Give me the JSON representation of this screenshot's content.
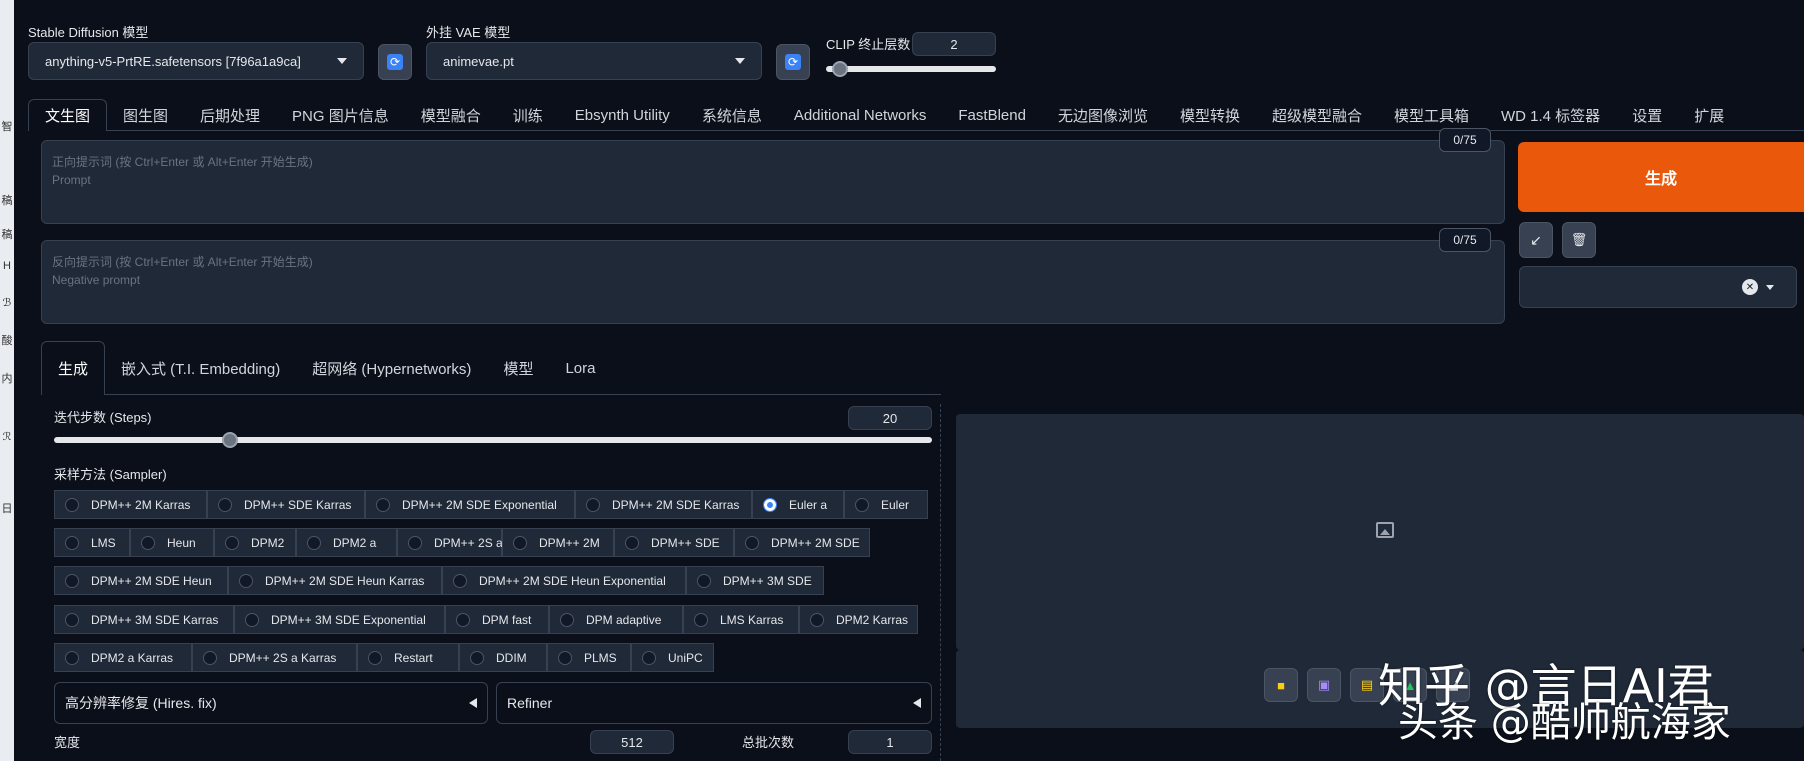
{
  "left_strip": [
    "智",
    "稿",
    "稿",
    "H",
    "ℬ",
    "酸",
    "内",
    "ℛ",
    "日"
  ],
  "models": {
    "sd_label": "Stable Diffusion 模型",
    "sd_value": "anything-v5-PrtRE.safetensors [7f96a1a9ca]",
    "vae_label": "外挂 VAE 模型",
    "vae_value": "animevae.pt",
    "clip_label": "CLIP 终止层数",
    "clip_value": "2",
    "clip_level": 0.08
  },
  "main_tabs": [
    "文生图",
    "图生图",
    "后期处理",
    "PNG 图片信息",
    "模型融合",
    "训练",
    "Ebsynth Utility",
    "系统信息",
    "Additional Networks",
    "FastBlend",
    "无边图像浏览",
    "模型转换",
    "超级模型融合",
    "模型工具箱",
    "WD 1.4 标签器",
    "设置",
    "扩展"
  ],
  "prompt": {
    "placeholder_line1": "正向提示词 (按 Ctrl+Enter 或 Alt+Enter 开始生成)",
    "placeholder_line2": "Prompt",
    "counter": "0/75"
  },
  "negative_prompt": {
    "placeholder_line1": "反向提示词 (按 Ctrl+Enter 或 Alt+Enter 开始生成)",
    "placeholder_line2": "Negative prompt",
    "counter": "0/75"
  },
  "generate_label": "生成",
  "tools": {
    "read_icon": "↙",
    "trash_icon": "🗑",
    "clear_icon": "✕"
  },
  "sub_tabs": [
    "生成",
    "嵌入式 (T.I. Embedding)",
    "超网络 (Hypernetworks)",
    "模型",
    "Lora"
  ],
  "steps": {
    "label": "迭代步数 (Steps)",
    "value": "20",
    "level": 0.2
  },
  "sampler": {
    "label": "采样方法 (Sampler)",
    "selected": "Euler a",
    "rows": [
      [
        "DPM++ 2M Karras",
        "DPM++ SDE Karras",
        "DPM++ 2M SDE Exponential",
        "DPM++ 2M SDE Karras",
        "Euler a",
        "Euler"
      ],
      [
        "LMS",
        "Heun",
        "DPM2",
        "DPM2 a",
        "DPM++ 2S a",
        "DPM++ 2M",
        "DPM++ SDE",
        "DPM++ 2M SDE"
      ],
      [
        "DPM++ 2M SDE Heun",
        "DPM++ 2M SDE Heun Karras",
        "DPM++ 2M SDE Heun Exponential",
        "DPM++ 3M SDE"
      ],
      [
        "DPM++ 3M SDE Karras",
        "DPM++ 3M SDE Exponential",
        "DPM fast",
        "DPM adaptive",
        "LMS Karras",
        "DPM2 Karras"
      ],
      [
        "DPM2 a Karras",
        "DPM++ 2S a Karras",
        "Restart",
        "DDIM",
        "PLMS",
        "UniPC"
      ]
    ]
  },
  "hires_label": "高分辨率修复 (Hires. fix)",
  "refiner_label": "Refiner",
  "width": {
    "label": "宽度",
    "value": "512"
  },
  "batch_count": {
    "label": "总批次数",
    "value": "1"
  },
  "output_icons": [
    "folder-icon",
    "save-icon",
    "zip-icon",
    "send-icon",
    "extra-icon"
  ],
  "watermark": {
    "line1": "知乎 @言日AI君",
    "line2": "头条 @酷帅航海家"
  },
  "colors": {
    "accent": "#ea580c",
    "bg": "#0b0f19",
    "panel": "#1f2937",
    "border": "#374151",
    "radio_on": "#3b82f6"
  }
}
